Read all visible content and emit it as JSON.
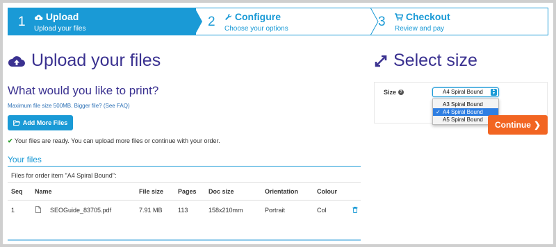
{
  "steps": [
    {
      "num": "1",
      "title": "Upload",
      "sub": "Upload your files",
      "icon": "cloud-upload-icon"
    },
    {
      "num": "2",
      "title": "Configure",
      "sub": "Choose your options",
      "icon": "wrench-icon"
    },
    {
      "num": "3",
      "title": "Checkout",
      "sub": "Review and pay",
      "icon": "cart-icon"
    }
  ],
  "upload": {
    "heading": "Upload your files",
    "question": "What would you like to print?",
    "max_size": "Maximum file size 500MB. Bigger file? (See FAQ)",
    "add_button": "Add More Files",
    "ready_msg": "Your files are ready. You can upload more files or continue with your order.",
    "your_files": "Your files",
    "order_item": "Files for order item \"A4 Spiral Bound\":"
  },
  "table": {
    "headers": [
      "Seq",
      "Name",
      "File size",
      "Pages",
      "Doc size",
      "Orientation",
      "Colour"
    ],
    "rows": [
      {
        "seq": "1",
        "name": "SEOGuide_83705.pdf",
        "size": "7.91 MB",
        "pages": "113",
        "doc_size": "158x210mm",
        "orientation": "Portrait",
        "colour": "Col"
      }
    ]
  },
  "size": {
    "heading": "Select size",
    "label": "Size",
    "selected": "A4 Spiral Bound",
    "options": [
      "A3 Spiral Bound",
      "A4 Spiral Bound",
      "A5 Spiral Bound"
    ],
    "continue": "Continue"
  },
  "colors": {
    "accent": "#1a9ad6",
    "heading": "#3a3190",
    "cta": "#f26522"
  }
}
